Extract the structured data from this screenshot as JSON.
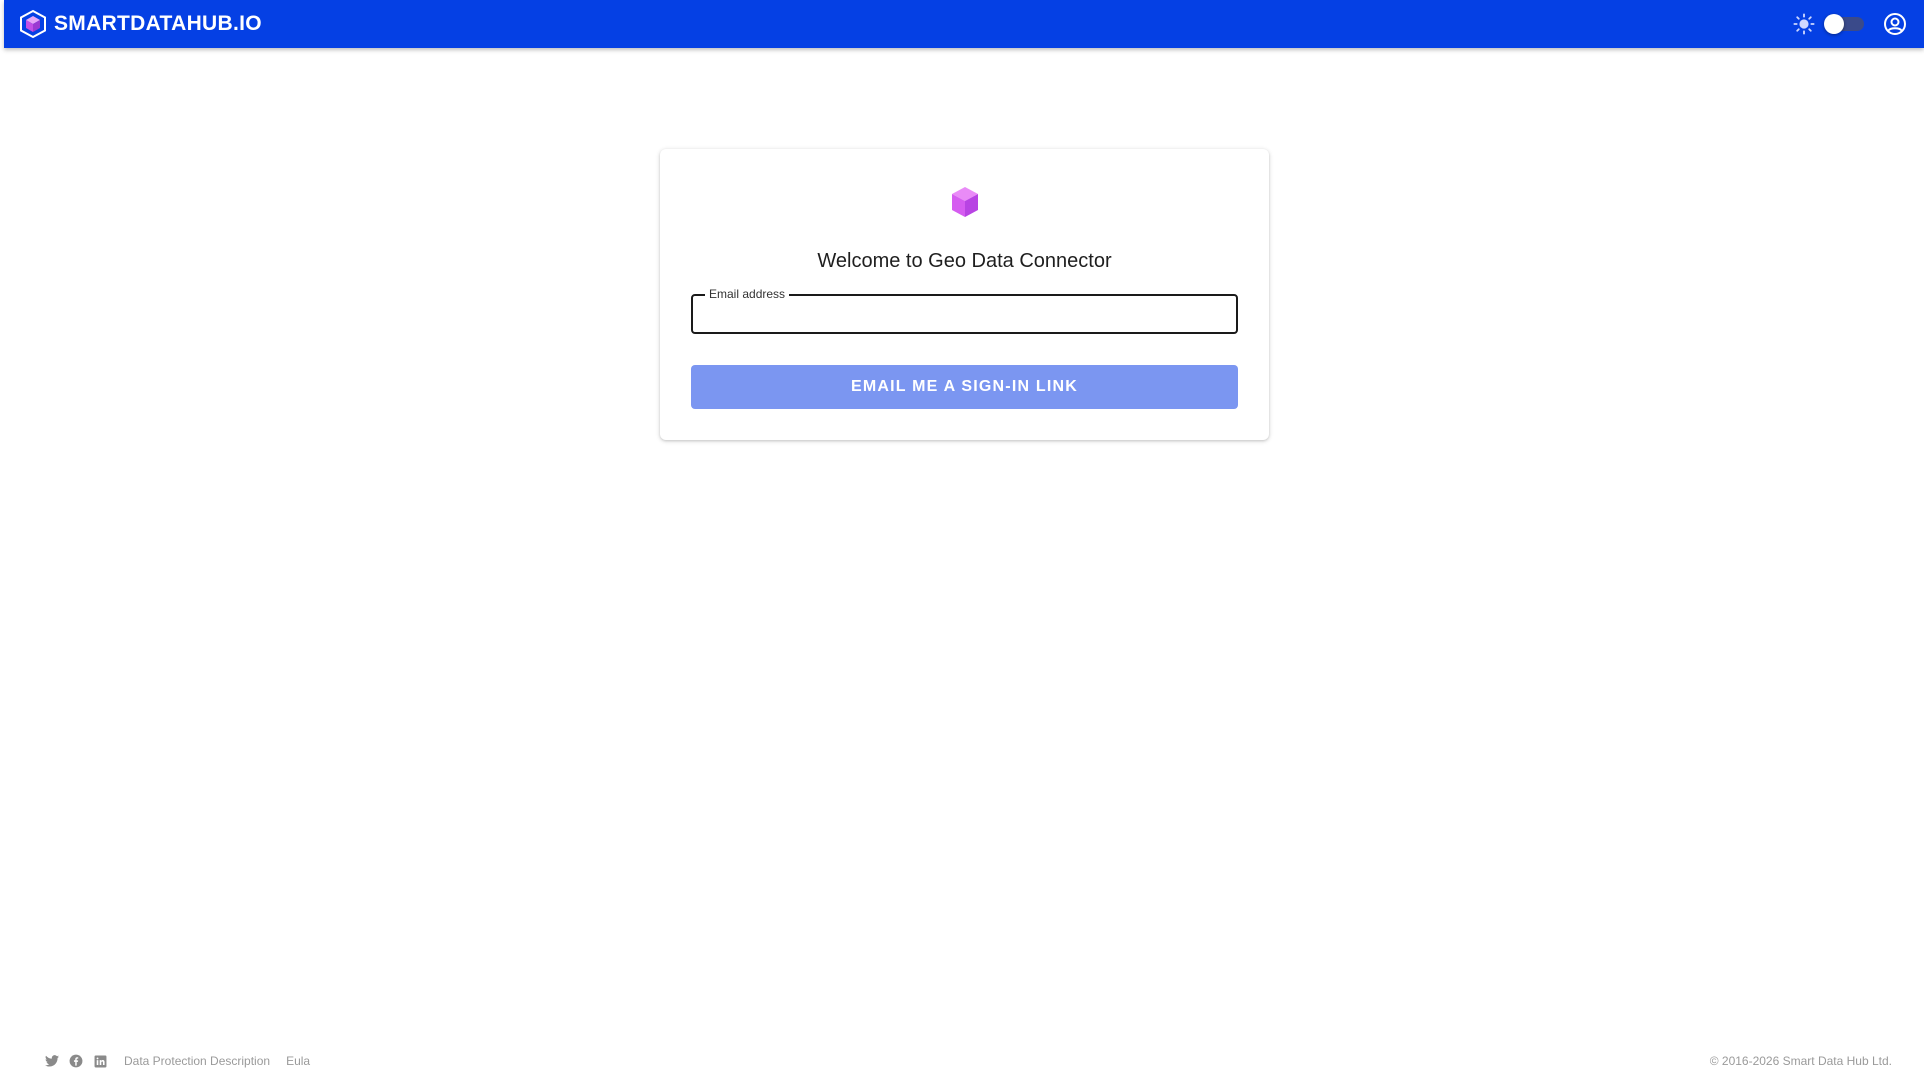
{
  "header": {
    "brand": "SMARTDATAHUB.IO",
    "theme_toggle": "dark-mode-toggle",
    "icons": [
      "cube-logo-icon",
      "sun-icon",
      "account-icon"
    ]
  },
  "login": {
    "title": "Welcome to Geo Data Connector",
    "email_label": "Email address",
    "email_value": "",
    "submit_label": "EMAIL ME A SIGN-IN LINK"
  },
  "footer": {
    "social_icons": [
      "twitter-icon",
      "facebook-icon",
      "linkedin-icon"
    ],
    "links": [
      "Data Protection Description",
      "Eula"
    ],
    "copyright": "© 2016-2026 Smart Data Hub Ltd."
  },
  "colors": {
    "appbar": "#0540e4",
    "button": "#7b96f1",
    "logo_purple": "#d55cf0"
  }
}
